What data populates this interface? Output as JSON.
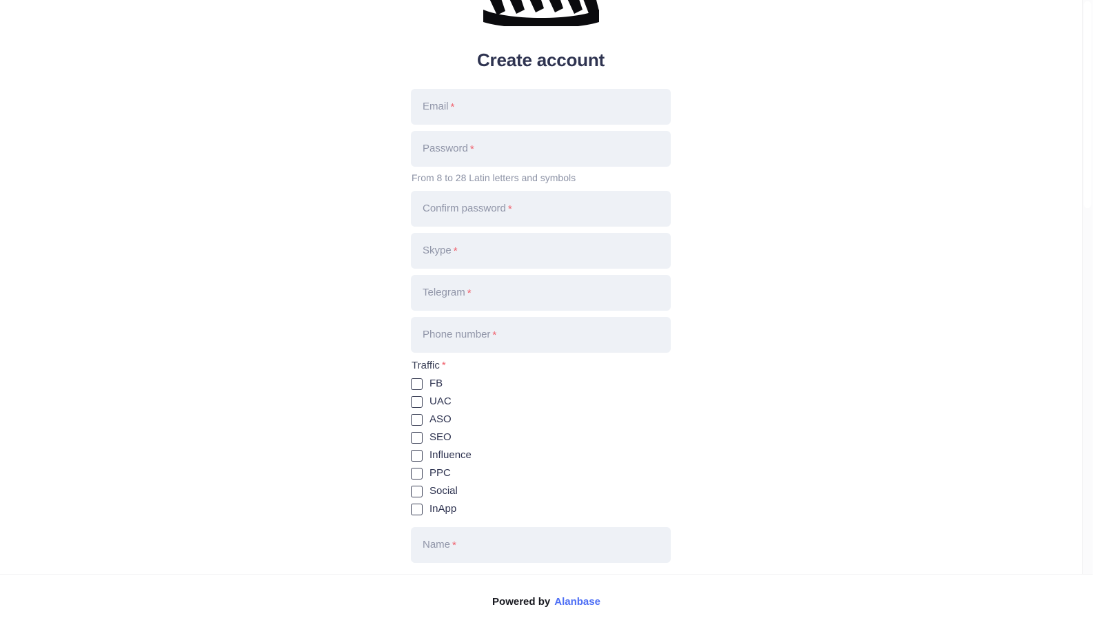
{
  "brand": {
    "logo_text": "PARTNERS",
    "logo_icon": "partners-wordmark-logo"
  },
  "heading": {
    "title": "Create account"
  },
  "form": {
    "fields": [
      {
        "id": "email",
        "label": "Email",
        "placeholder": "Email",
        "value": "",
        "required_mark": "*",
        "hint": ""
      },
      {
        "id": "password",
        "label": "Password",
        "placeholder": "Password",
        "value": "",
        "required_mark": "*",
        "hint": "From 8 to 28 Latin letters and symbols"
      },
      {
        "id": "confirm-password",
        "label": "Confirm password",
        "placeholder": "Confirm password",
        "value": "",
        "required_mark": "*",
        "hint": ""
      },
      {
        "id": "skype",
        "label": "Skype",
        "placeholder": "Skype",
        "value": "",
        "required_mark": "*",
        "hint": ""
      },
      {
        "id": "telegram",
        "label": "Telegram",
        "placeholder": "Telegram",
        "value": "",
        "required_mark": "*",
        "hint": ""
      },
      {
        "id": "phone-number",
        "label": "Phone number",
        "placeholder": "Phone number",
        "value": "",
        "required_mark": "*",
        "hint": ""
      }
    ],
    "traffic": {
      "label": "Traffic",
      "required_mark": "*",
      "options": [
        {
          "id": "fb",
          "label": "FB",
          "checked": false
        },
        {
          "id": "uac",
          "label": "UAC",
          "checked": false
        },
        {
          "id": "aso",
          "label": "ASO",
          "checked": false
        },
        {
          "id": "seo",
          "label": "SEO",
          "checked": false
        },
        {
          "id": "influence",
          "label": "Influence",
          "checked": false
        },
        {
          "id": "ppc",
          "label": "PPC",
          "checked": false
        },
        {
          "id": "social",
          "label": "Social",
          "checked": false
        },
        {
          "id": "inapp",
          "label": "InApp",
          "checked": false
        }
      ]
    },
    "trailing_fields": [
      {
        "id": "name",
        "label": "Name",
        "placeholder": "Name",
        "value": "",
        "required_mark": "*",
        "hint": ""
      }
    ]
  },
  "footer": {
    "powered_by": "Powered by",
    "link_label": "Alanbase"
  },
  "colors": {
    "field_background": "#eef1f6",
    "placeholder": "#9095a8",
    "required_asterisk": "#f0616d",
    "heading": "#2e3350",
    "hint": "#8d93a6",
    "checkbox_border": "#3d4258",
    "footer_link": "#4d6ef5",
    "page_background": "#ffffff"
  }
}
